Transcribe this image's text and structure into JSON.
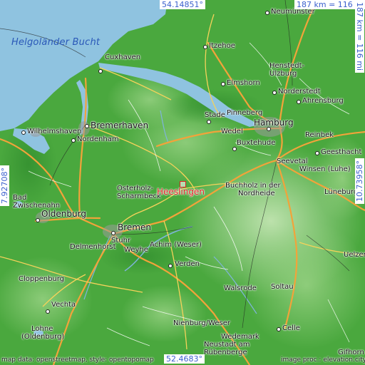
{
  "map": {
    "title_coords": {
      "top_lat": "54.14851°",
      "bottom_lat": "52.4683°",
      "left_lon": "7.92708°",
      "right_lon": "10.73958°"
    },
    "scale": {
      "horizontal": "187 km = 116 mi",
      "vertical": "187 km = 116 mi"
    },
    "water": {
      "bay": "Helgoländer Bucht"
    },
    "marker": {
      "name": "Heeslingen"
    },
    "places": {
      "neumuenster": "Neumünster",
      "itzehoe": "Itzehoe",
      "cuxhaven": "Cuxhaven",
      "henstedt": "Henstedt-",
      "ulzburg": "Ulzburg",
      "elmshorn": "Elmshorn",
      "norderstedt": "Norderstedt",
      "ahrensburg": "Ahrensburg",
      "bremerhaven": "Bremerhaven",
      "stade": "Stade",
      "pinneberg": "Pinneberg",
      "hamburg": "Hamburg",
      "wilhelmshaven": "Wilhelmshaven",
      "nordenham": "Nordenham",
      "wedel": "Wedel",
      "buxtehude": "Buxtehude",
      "reinbek": "Reinbek",
      "geesthacht": "Geesthacht",
      "seevetal": "Seevetal",
      "winsen": "Winsen (Luhe)",
      "osterholz": "Osterholz-",
      "scharmbeck": "Scharmbeck",
      "buchholz": "Buchholz in der",
      "nordheide": "Nordheide",
      "bad": "Bad",
      "zwischenahn": "Zwischenahn",
      "lueneburg": "Lüneburg",
      "oldenburg": "Oldenburg",
      "bremen": "Bremen",
      "stuhr": "Stuhr",
      "delmenhorst": "Delmenhorst",
      "weyhe": "Weyhe",
      "achim": "Achim (Weser)",
      "verden": "Verden",
      "uelzen": "Uelzen",
      "cloppenburg": "Cloppenburg",
      "vechta": "Vechta",
      "nienburg": "Nienburg/Weser",
      "lohne": "Lohne",
      "lohne2": "(Oldenburg)",
      "walsrode": "Walsrode",
      "soltau": "Soltau",
      "wedemark": "Wedemark",
      "celle": "Celle",
      "neustadt": "Neustadt am",
      "ruebenberge": "Rübenberge",
      "gifhorn": "Gifhorn"
    },
    "credits": {
      "left": "map data: openstreetmap, style: opentopomap",
      "right": "image proc.: elevation.city"
    },
    "colors": {
      "sea": "#8fc3e0",
      "land": "#4aa83e",
      "road_major": "#f2a33a",
      "road_minor": "#ffffff",
      "marker": "#e02020",
      "coord_text": "#3a5fcd"
    }
  }
}
